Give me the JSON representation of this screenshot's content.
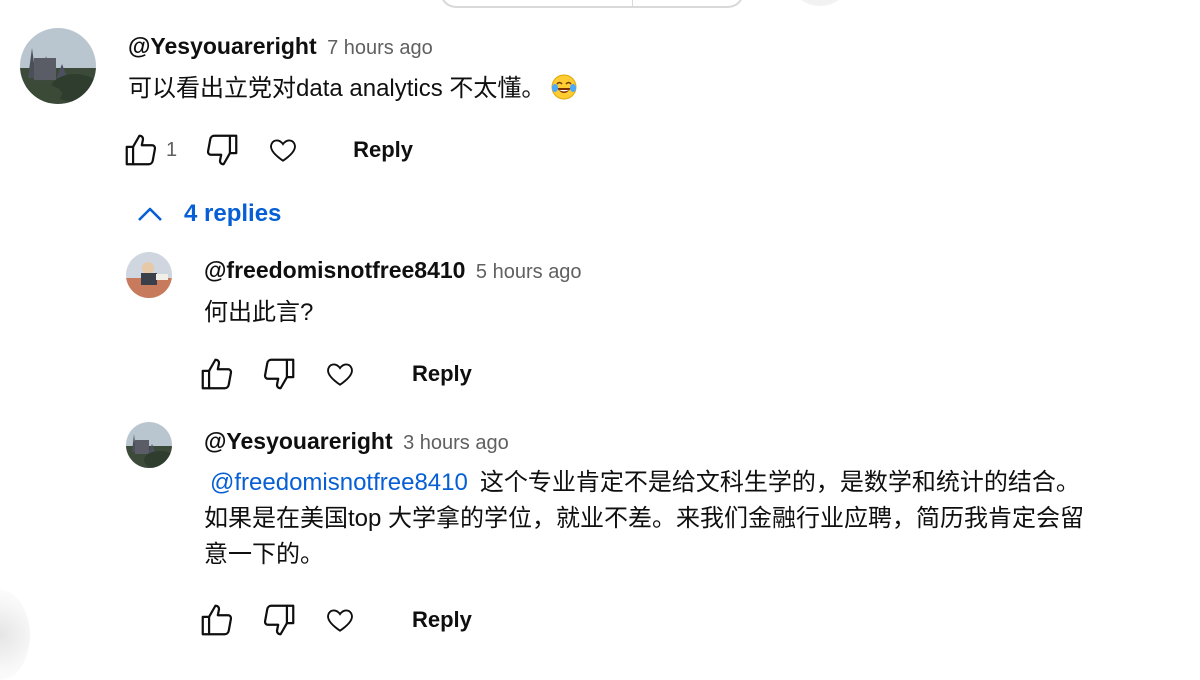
{
  "comments": {
    "main": {
      "author": "@Yesyouareright",
      "time": "7 hours ago",
      "text": "可以看出立党对data analytics 不太懂。",
      "emoji": "tears-of-joy-emoji",
      "like_count": "1",
      "reply_label": "Reply"
    },
    "replies_toggle": {
      "label": "4 replies",
      "icon": "chevron-up-icon"
    },
    "reply1": {
      "author": "@freedomisnotfree8410",
      "time": "5 hours ago",
      "text": "何出此言?",
      "reply_label": "Reply"
    },
    "reply2": {
      "author": "@Yesyouareright",
      "time": "3 hours ago",
      "mention": "@freedomisnotfree8410",
      "text_line1": "这个专业肯定不是给文科生学的，是数学和统计的结合。",
      "text_line2": "如果是在美国top 大学拿的学位，就业不差。来我们金融行业应聘，简历我肯定会留",
      "text_line3": "意一下的。",
      "reply_label": "Reply"
    }
  },
  "icons": [
    "like-icon",
    "dislike-icon",
    "heart-icon",
    "chevron-up-icon"
  ],
  "colors": {
    "link": "#065fd4",
    "text": "#0f0f0f",
    "secondary": "#606060"
  }
}
